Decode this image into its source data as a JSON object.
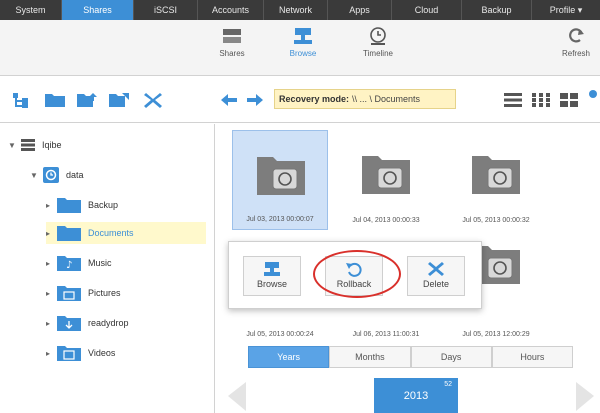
{
  "topnav": {
    "tabs": [
      {
        "label": "System",
        "active": false
      },
      {
        "label": "Shares",
        "active": true
      },
      {
        "label": "iSCSI",
        "active": false
      },
      {
        "label": "Accounts",
        "active": false
      },
      {
        "label": "Network",
        "active": false
      },
      {
        "label": "Apps",
        "active": false
      },
      {
        "label": "Cloud",
        "active": false
      },
      {
        "label": "Backup",
        "active": false
      },
      {
        "label": "Profile ▾",
        "active": false
      }
    ]
  },
  "subnav": {
    "shares": "Shares",
    "browse": "Browse",
    "timeline": "Timeline",
    "refresh": "Refresh"
  },
  "toolbar": {
    "recovery_label": "Recovery mode:",
    "recovery_path": "\\\\ ... \\ Documents"
  },
  "sidebar": {
    "volume": "Iqibe",
    "share": "data",
    "folders": [
      "Backup",
      "Documents",
      "Music",
      "Pictures",
      "readydrop",
      "Videos"
    ],
    "selected": "Documents"
  },
  "snapshots": [
    {
      "caption": "Jul 03, 2013 00:00:07"
    },
    {
      "caption": "Jul 04, 2013 00:00:33"
    },
    {
      "caption": "Jul 05, 2013 00:00:32"
    },
    {
      "caption": "Jul 05, 2013 00:00:24"
    },
    {
      "caption": "Jul 06, 2013 11:00:31"
    },
    {
      "caption": "Jul 05, 2013 12:00:29"
    }
  ],
  "popup": {
    "browse": "Browse",
    "rollback": "Rollback",
    "delete": "Delete"
  },
  "timetabs": [
    "Years",
    "Months",
    "Days",
    "Hours"
  ],
  "year": {
    "value": "2013",
    "count": "52"
  },
  "colors": {
    "accent": "#3d8fd6",
    "highlight_ring": "#d9302b",
    "selected_bg": "#cfe1f7",
    "recovery_bg": "#fff3c4"
  }
}
